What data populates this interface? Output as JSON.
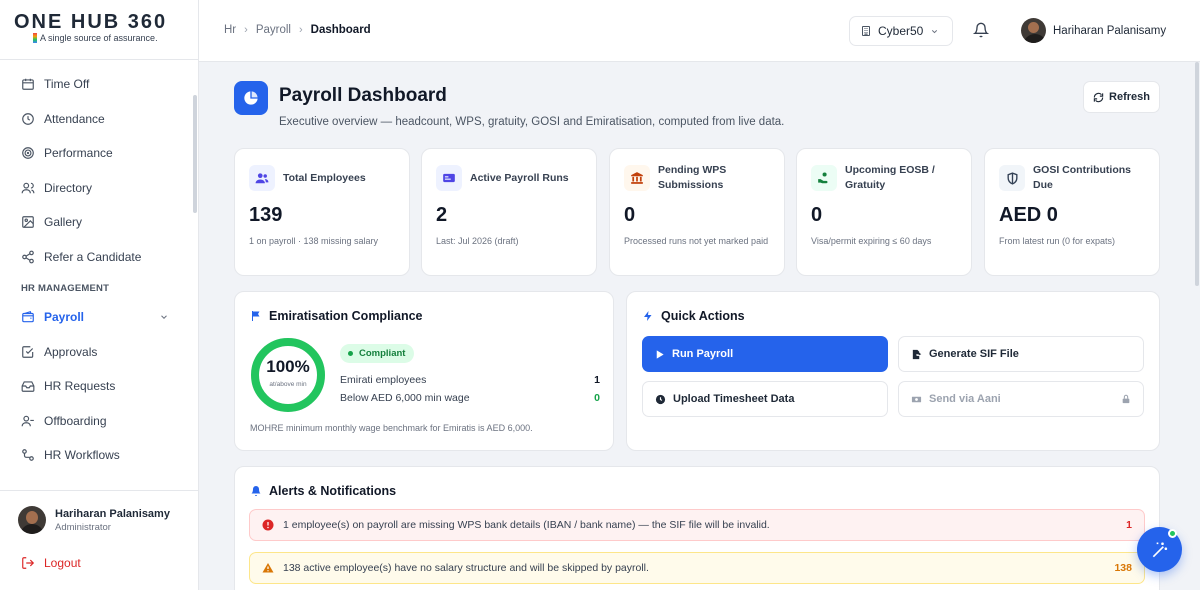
{
  "brand": {
    "logo_text": "ONE HUB 360",
    "tagline": "A single source of assurance."
  },
  "sidebar": {
    "items": [
      {
        "label": "Time Off",
        "icon": "calendar-icon"
      },
      {
        "label": "Attendance",
        "icon": "clock-icon"
      },
      {
        "label": "Performance",
        "icon": "target-icon"
      },
      {
        "label": "Directory",
        "icon": "users-icon"
      },
      {
        "label": "Gallery",
        "icon": "image-icon"
      },
      {
        "label": "Refer a Candidate",
        "icon": "share-icon"
      }
    ],
    "section_label": "HR MANAGEMENT",
    "hr_items": [
      {
        "label": "Payroll",
        "icon": "wallet-icon",
        "active": true
      },
      {
        "label": "Approvals",
        "icon": "check-square-icon"
      },
      {
        "label": "HR Requests",
        "icon": "inbox-icon"
      },
      {
        "label": "Offboarding",
        "icon": "user-minus-icon"
      },
      {
        "label": "HR Workflows",
        "icon": "workflow-icon"
      }
    ],
    "user": {
      "name": "Hariharan Palanisamy",
      "role": "Administrator"
    },
    "logout_label": "Logout"
  },
  "header": {
    "breadcrumb": [
      "Hr",
      "Payroll",
      "Dashboard"
    ],
    "tenant": "Cyber50",
    "user_name": "Hariharan Palanisamy"
  },
  "page": {
    "title": "Payroll Dashboard",
    "subtitle": "Executive overview — headcount, WPS, gratuity, GOSI and Emiratisation, computed from live data.",
    "refresh_label": "Refresh"
  },
  "stats": [
    {
      "label": "Total Employees",
      "value": "139",
      "note": "1 on payroll · 138 missing salary",
      "icon": "users-icon",
      "icon_bg": "#eef2ff",
      "icon_color": "#4f46e5"
    },
    {
      "label": "Active Payroll Runs",
      "value": "2",
      "note": "Last: Jul 2026 (draft)",
      "icon": "id-card-icon",
      "icon_bg": "#eef2ff",
      "icon_color": "#4f46e5"
    },
    {
      "label": "Pending WPS Submissions",
      "value": "0",
      "note": "Processed runs not yet marked paid",
      "icon": "bank-icon",
      "icon_bg": "#fff7ed",
      "icon_color": "#c2410c"
    },
    {
      "label": "Upcoming EOSB / Gratuity",
      "value": "0",
      "note": "Visa/permit expiring ≤ 60 days",
      "icon": "hand-coin-icon",
      "icon_bg": "#ecfdf5",
      "icon_color": "#15803d"
    },
    {
      "label": "GOSI Contributions Due",
      "value": "AED 0",
      "note": "From latest run (0 for expats)",
      "icon": "shield-icon",
      "icon_bg": "#f1f5f9",
      "icon_color": "#334155"
    }
  ],
  "emiratisation": {
    "title": "Emiratisation Compliance",
    "percent_label": "100%",
    "percent_value": 100,
    "ring_sub": "at/above min",
    "status": "Compliant",
    "rows": [
      {
        "label": "Emirati employees",
        "value": "1"
      },
      {
        "label": "Below AED 6,000 min wage",
        "value": "0"
      }
    ],
    "note": "MOHRE minimum monthly wage benchmark for Emiratis is AED 6,000."
  },
  "quick_actions": {
    "title": "Quick Actions",
    "run_payroll": "Run Payroll",
    "generate_sif": "Generate SIF File",
    "upload_timesheet": "Upload Timesheet Data",
    "send_aani": "Send via Aani"
  },
  "alerts": {
    "title": "Alerts & Notifications",
    "items": [
      {
        "text": "1 employee(s) on payroll are missing WPS bank details (IBAN / bank name) — the SIF file will be invalid.",
        "count": "1",
        "severity": "error"
      },
      {
        "text": "138 active employee(s) have no salary structure and will be skipped by payroll.",
        "count": "138",
        "severity": "warning"
      }
    ]
  },
  "colors": {
    "accent": "#2563eb",
    "success": "#22c55e",
    "danger": "#dc2626",
    "warning": "#d97706"
  }
}
